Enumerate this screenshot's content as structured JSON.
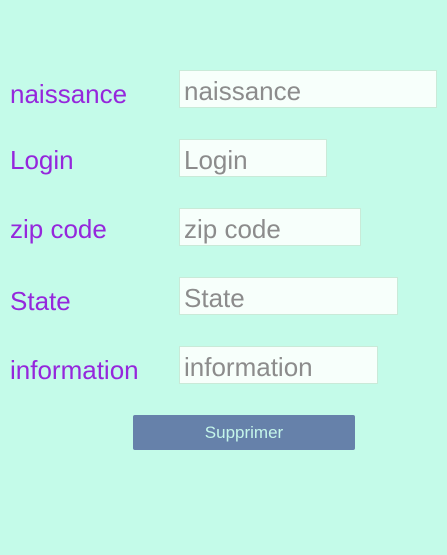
{
  "form": {
    "fields": [
      {
        "label": "naissance",
        "placeholder": "naissance",
        "value": ""
      },
      {
        "label": "Login",
        "placeholder": "Login",
        "value": ""
      },
      {
        "label": "zip code",
        "placeholder": "zip code",
        "value": ""
      },
      {
        "label": "State",
        "placeholder": "State",
        "value": ""
      },
      {
        "label": "information",
        "placeholder": "information",
        "value": ""
      }
    ],
    "submit_label": "Supprimer"
  },
  "colors": {
    "background": "#c4fbe9",
    "label": "#9527dc",
    "field_background": "#f7fffb",
    "field_border": "#c9ead8",
    "placeholder": "#8c8c8c",
    "button": "#6681aa",
    "button_text": "#c4f6ea"
  }
}
